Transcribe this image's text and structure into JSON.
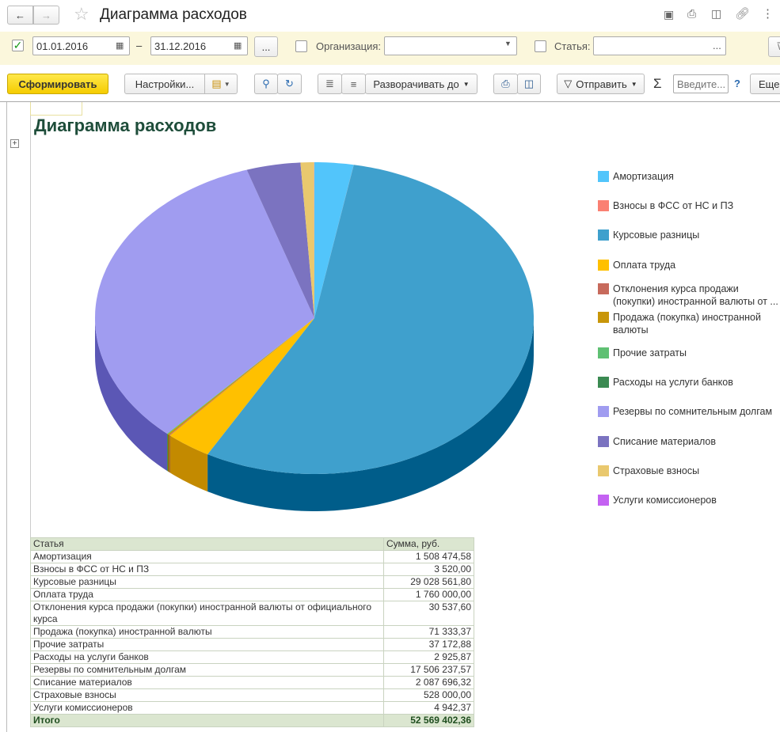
{
  "window": {
    "title": "Диаграмма расходов"
  },
  "filters": {
    "date_from": "01.01.2016",
    "date_sep": "–",
    "date_to": "31.12.2016",
    "more": "...",
    "org_label": "Организация:",
    "org_value": "",
    "article_label": "Статья:",
    "article_value": "",
    "article_more": "..."
  },
  "toolbar": {
    "generate": "Сформировать",
    "settings": "Настройки...",
    "expand": "Разворачивать до",
    "send": "Отправить",
    "sigma": "Σ",
    "search_placeholder": "Введите...",
    "help": "?",
    "more": "Еще"
  },
  "report": {
    "title": "Диаграмма расходов",
    "col_article": "Статья",
    "col_sum": "Сумма, руб.",
    "total_label": "Итого",
    "total": "52 569 402,36"
  },
  "chart_data": {
    "type": "pie",
    "title": "Диаграмма расходов",
    "legend_position": "right",
    "categories": [
      "Амортизация",
      "Взносы в ФСС от НС и ПЗ",
      "Курсовые разницы",
      "Оплата труда",
      "Отклонения курса продажи (покупки) иностранной валюты от официального курса",
      "Продажа (покупка) иностранной валюты",
      "Прочие затраты",
      "Расходы на услуги банков",
      "Резервы по сомнительным долгам",
      "Списание материалов",
      "Страховые взносы",
      "Услуги комиссионеров"
    ],
    "legend_labels": [
      "Амортизация",
      "Взносы в ФСС от НС и ПЗ",
      "Курсовые разницы",
      "Оплата труда",
      "Отклонения курса продажи (покупки) иностранной валюты от ...",
      "Продажа (покупка) иностранной валюты",
      "Прочие затраты",
      "Расходы на услуги банков",
      "Резервы по сомнительным долгам",
      "Списание материалов",
      "Страховые взносы",
      "Услуги комиссионеров"
    ],
    "values": [
      1508474.58,
      3520.0,
      29028561.8,
      1760000.0,
      30537.6,
      71333.37,
      37172.88,
      2925.87,
      17506237.57,
      2087696.32,
      528000.0,
      4942.37
    ],
    "display_values": [
      "1 508 474,58",
      "3 520,00",
      "29 028 561,80",
      "1 760 000,00",
      "30 537,60",
      "71 333,37",
      "37 172,88",
      "2 925,87",
      "17 506 237,57",
      "2 087 696,32",
      "528 000,00",
      "4 942,37"
    ],
    "colors": [
      "#52c5fb",
      "#fa8072",
      "#3fa0cd",
      "#ffc000",
      "#c76a5c",
      "#c8960a",
      "#5fc073",
      "#3b8a52",
      "#a09cf0",
      "#7b73c0",
      "#e9c86e",
      "#c462f2"
    ],
    "side_colors": [
      "#2a8fc0",
      "#c05a50",
      "#005d8a",
      "#c38a00",
      "#8a4038",
      "#8f6a00",
      "#3a8a4a",
      "#255a33",
      "#5b57b5",
      "#5049a0",
      "#b09440",
      "#8a3ab5"
    ]
  }
}
